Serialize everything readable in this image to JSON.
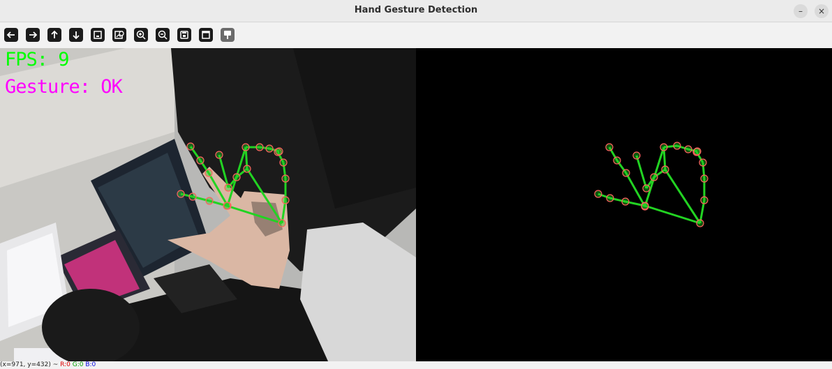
{
  "window": {
    "title": "Hand Gesture Detection",
    "minimize_label": "–",
    "close_label": "×"
  },
  "toolbar": {
    "buttons": [
      {
        "icon": "arrow-left-icon",
        "label": "pan-left"
      },
      {
        "icon": "arrow-right-icon",
        "label": "pan-right"
      },
      {
        "icon": "arrow-up-icon",
        "label": "pan-up"
      },
      {
        "icon": "arrow-down-icon",
        "label": "pan-down"
      },
      {
        "icon": "zoom-fit-icon",
        "label": "zoom-in-original"
      },
      {
        "icon": "image-zoom-icon",
        "label": "zoom-original"
      },
      {
        "icon": "zoom-in-icon",
        "label": "zoom-in"
      },
      {
        "icon": "zoom-out-icon",
        "label": "zoom-out"
      },
      {
        "icon": "save-icon",
        "label": "save"
      },
      {
        "icon": "properties-icon",
        "label": "properties"
      },
      {
        "icon": "paint-icon",
        "label": "overlay"
      }
    ]
  },
  "overlay": {
    "fps": "FPS: 9",
    "gesture": "Gesture: OK",
    "fps_color": "#00ff00",
    "gesture_color": "#ff00ff"
  },
  "skeleton": {
    "line_color": "#22d322",
    "joint_color": "#ff6060"
  },
  "status": {
    "coords": "(x=971, y=432) ~ ",
    "r": "R:0",
    "g": "G:0",
    "b": "B:0"
  }
}
